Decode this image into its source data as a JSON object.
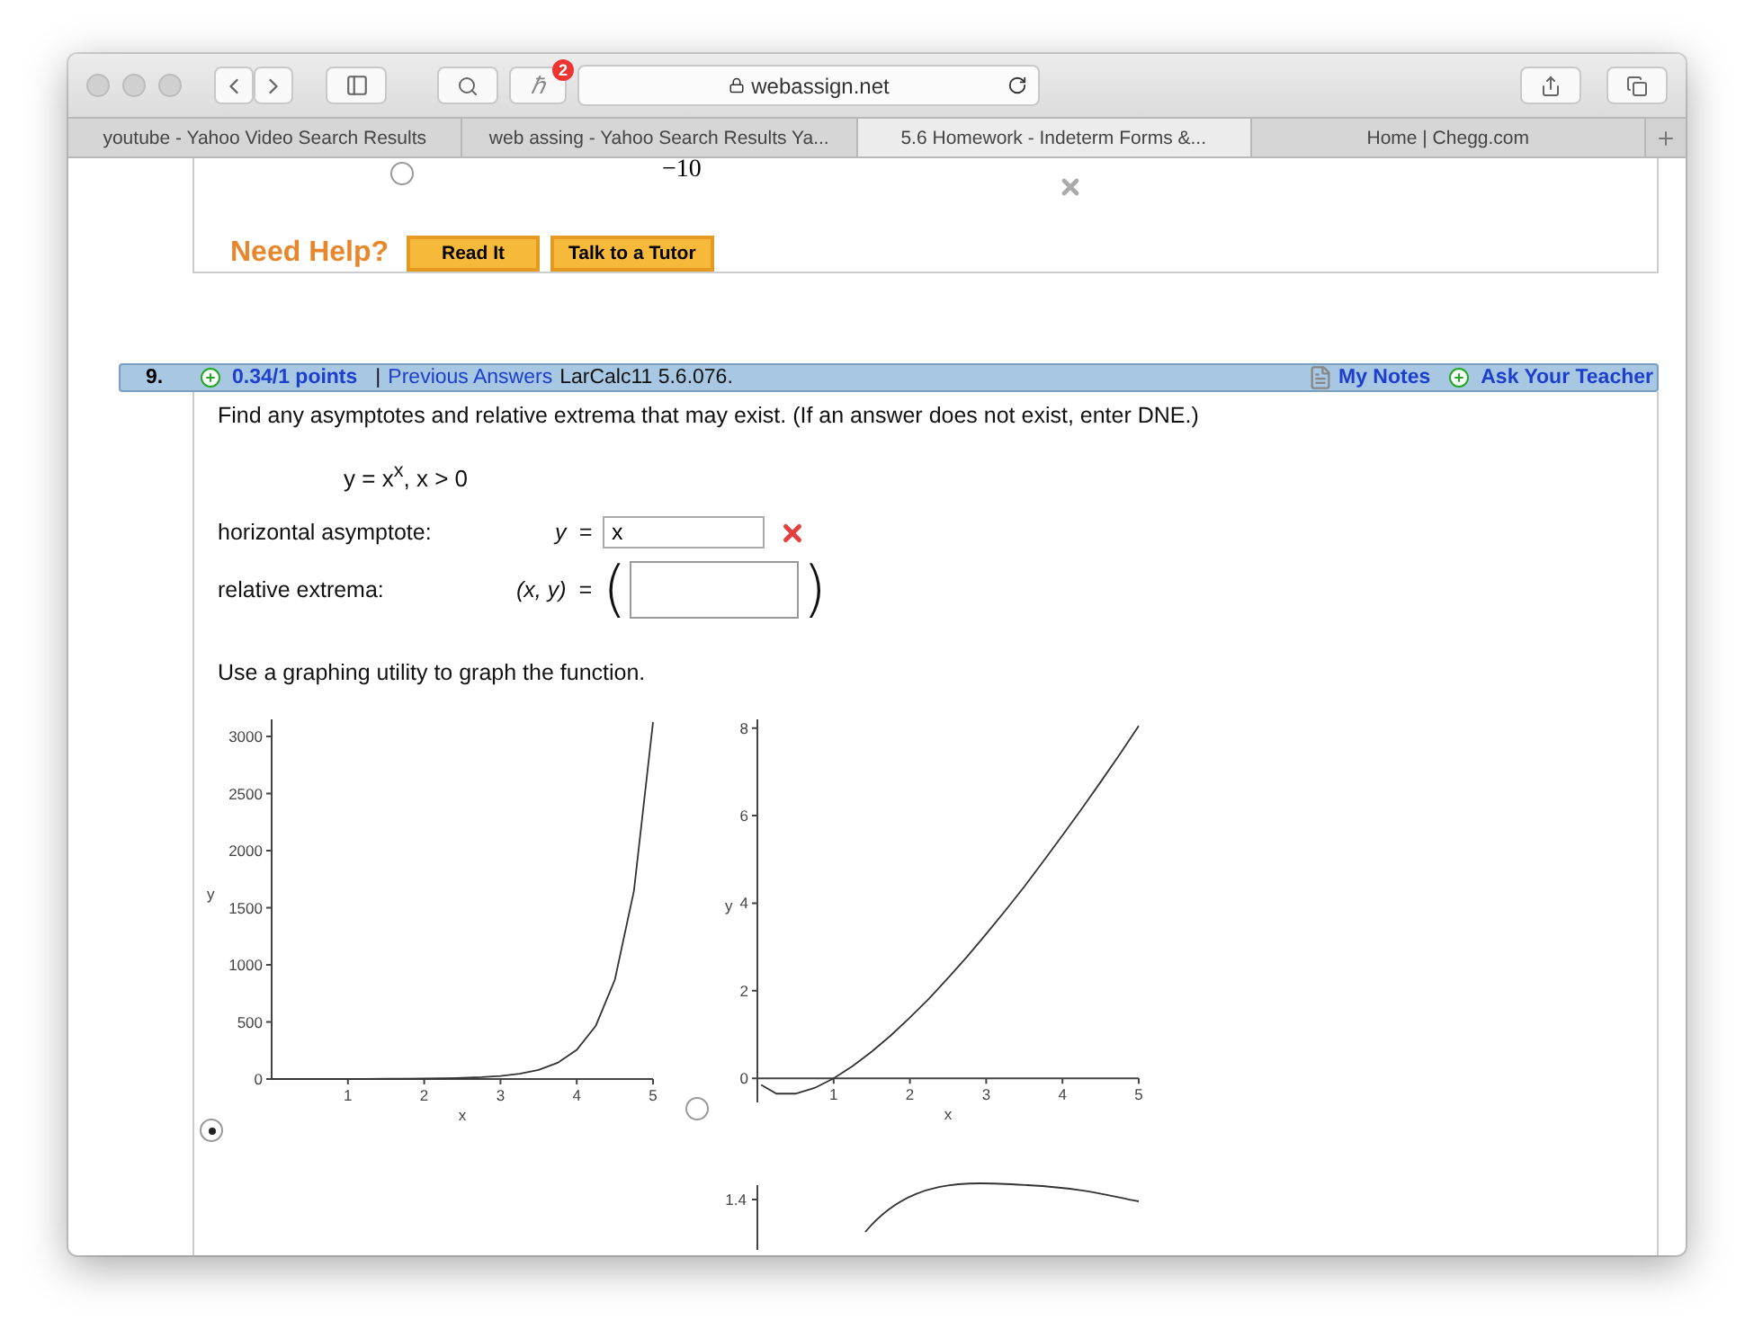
{
  "browser": {
    "address": "webassign.net",
    "notification_count": "2",
    "extension_glyph": "ℏ",
    "tabs": [
      {
        "label": "youtube - Yahoo Video Search Results",
        "selected": false
      },
      {
        "label": "web assing - Yahoo Search Results Ya...",
        "selected": false
      },
      {
        "label": "5.6 Homework - Indeterm Forms &...",
        "selected": true
      },
      {
        "label": "Home | Chegg.com",
        "selected": false
      }
    ]
  },
  "previous_question": {
    "visible_axis_text": "−10",
    "option_selected": false,
    "marked_incorrect": true,
    "help_label": "Need Help?",
    "help_buttons": [
      "Read It",
      "Talk to a Tutor"
    ]
  },
  "question": {
    "number": "9.",
    "points": "0.34/1 points",
    "separator": "|",
    "previous_answers": "Previous Answers",
    "source": "LarCalc11 5.6.076.",
    "my_notes": "My Notes",
    "ask_teacher": "Ask Your Teacher",
    "prompt": "Find any asymptotes and relative extrema that may exist. (If an answer does not exist, enter DNE.)",
    "equation": "y = x$^{x}$,  x > 0",
    "answers": [
      {
        "kind": "single",
        "label": "horizontal asymptote:",
        "lhs": "y  =",
        "value": "x",
        "marked_incorrect": true
      },
      {
        "kind": "pair",
        "label": "relative extrema:",
        "lhs": "(x, y)  =",
        "open": "(",
        "close": ")"
      }
    ],
    "instruction": "Use a graphing utility to graph the function.",
    "graph_options": [
      {
        "kind": "chart",
        "selected": true,
        "chart_data": {
          "type": "line",
          "xlabel": "x",
          "ylabel": "y",
          "xlim": [
            0,
            5
          ],
          "ylim": [
            0,
            3150
          ],
          "xticks": [
            1,
            2,
            3,
            4,
            5
          ],
          "yticks": [
            0,
            500,
            1000,
            1500,
            2000,
            2500,
            3000
          ],
          "x": [
            0,
            0.25,
            0.5,
            0.75,
            1,
            1.25,
            1.5,
            1.75,
            2,
            2.25,
            2.5,
            2.75,
            3,
            3.25,
            3.5,
            3.75,
            4,
            4.25,
            4.5,
            4.75,
            5
          ],
          "series": [
            {
              "color": "#333333",
              "values": [
                1,
                1,
                1,
                1,
                1,
                1,
                2,
                3,
                4,
                6,
                10,
                16,
                27,
                46,
                80,
                142,
                256,
                467,
                870,
                1649,
                3125
              ]
            }
          ]
        }
      },
      {
        "kind": "chart",
        "selected": false,
        "chart_data": {
          "type": "line",
          "xlabel": "x",
          "ylabel": "y",
          "xlim": [
            0,
            5
          ],
          "ylim": [
            -0.55,
            8.2
          ],
          "xticks": [
            1,
            2,
            3,
            4,
            5
          ],
          "yticks": [
            0,
            2,
            4,
            6,
            8
          ],
          "x": [
            0.05,
            0.25,
            0.5,
            0.75,
            1,
            1.25,
            1.5,
            1.75,
            2,
            2.25,
            2.5,
            2.75,
            3,
            3.25,
            3.5,
            3.75,
            4,
            4.25,
            4.5,
            4.75,
            5
          ],
          "series": [
            {
              "color": "#333333",
              "values": [
                -0.15,
                -0.35,
                -0.35,
                -0.22,
                0,
                0.28,
                0.61,
                0.98,
                1.39,
                1.82,
                2.29,
                2.78,
                3.3,
                3.83,
                4.38,
                4.96,
                5.55,
                6.15,
                6.77,
                7.4,
                8.05
              ]
            }
          ]
        }
      },
      {
        "kind": "partial",
        "visible_tick": "1.4"
      }
    ]
  }
}
